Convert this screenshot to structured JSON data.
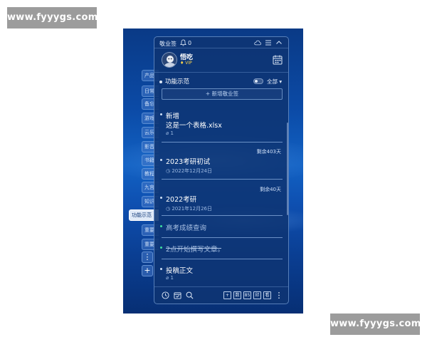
{
  "watermark": {
    "top": "www.fyyygs.com",
    "bottom": "www.fyyygs.com"
  },
  "side_tabs": {
    "items": [
      "产品",
      "日常",
      "备忘",
      "游戏",
      "云乐",
      "影音",
      "书籍",
      "教程",
      "九宫",
      "知识",
      "功能示范",
      "重要",
      "重要"
    ],
    "active": "功能示范",
    "more_label": "⋮",
    "add_label": "+"
  },
  "panel": {
    "title": "敬业签",
    "bell_count": "0",
    "user": {
      "name": "悟吃",
      "badge": "VIP"
    },
    "group_name": "功能示范",
    "filter_label": "全部",
    "add_label": "+ 新增敬业签",
    "items": [
      {
        "title": "新增",
        "subtitle": "这是一个表格.xlsx",
        "attach": "1"
      },
      {
        "remaining": "剩余403天",
        "title": "2023考研初试",
        "date": "2022年12月24日"
      },
      {
        "remaining": "剩余40天",
        "title": "2022考研",
        "date": "2021年12月26日"
      },
      {
        "title": "高考成绩查询",
        "done": true
      },
      {
        "title": "2点开始撰写文章。",
        "done": true
      },
      {
        "title": "投稿正文",
        "attach": "1"
      }
    ],
    "bottom": {
      "box1": "+",
      "box2": "数",
      "box3": "85",
      "box4": "印",
      "box5": "看"
    }
  },
  "colors": {
    "accent": "#3fe0a0",
    "vip": "#ffd64a",
    "panel_bg": "#0e3473",
    "desktop": "#0b4aa6"
  },
  "icons": [
    "bell-icon",
    "cloud-icon",
    "menu-icon",
    "collapse-icon",
    "calendar-icon",
    "paperclip-icon",
    "clock-icon",
    "search-icon",
    "more-icon"
  ]
}
